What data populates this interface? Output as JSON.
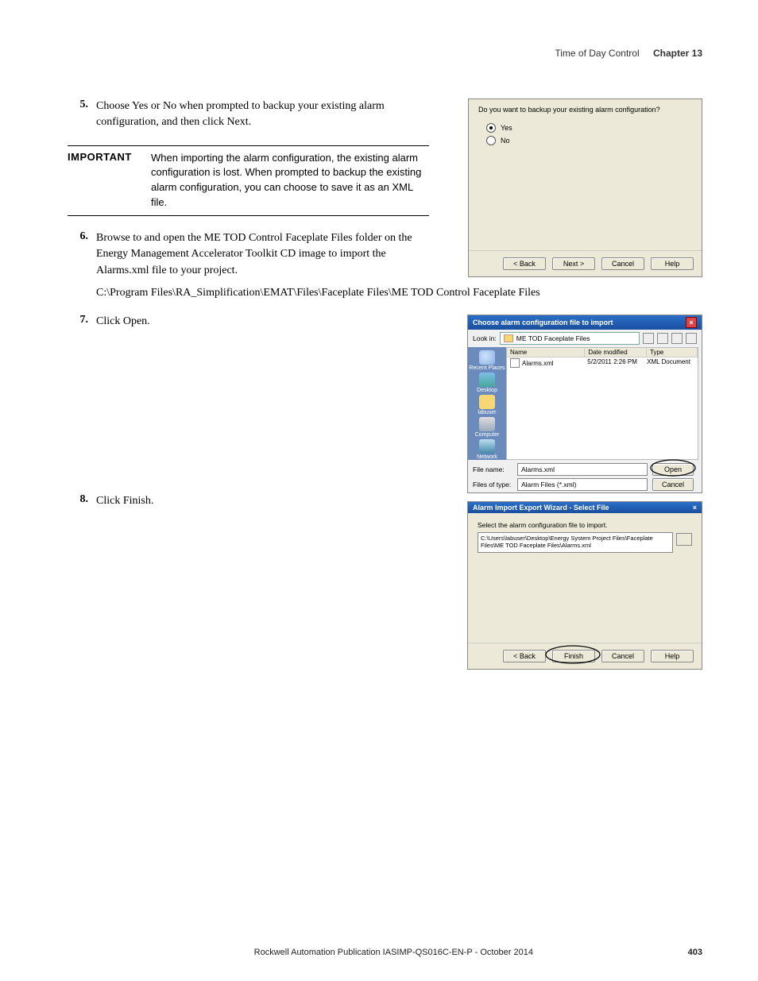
{
  "header": {
    "chapter_name": "Time of Day Control",
    "chapter_num": "Chapter 13"
  },
  "steps": {
    "s5": {
      "num": "5.",
      "text": "Choose Yes or No when prompted to backup your existing alarm configuration, and then click Next."
    },
    "s6": {
      "num": "6.",
      "text": "Browse to and open the ME TOD Control Faceplate Files folder on the Energy Management Accelerator Toolkit CD image to import the Alarms.xml file to your project."
    },
    "s7": {
      "num": "7.",
      "text": "Click Open."
    },
    "s8": {
      "num": "8.",
      "text": "Click Finish."
    }
  },
  "important": {
    "label": "IMPORTANT",
    "text": "When importing the alarm configuration, the existing alarm configuration is lost. When prompted to backup the existing alarm configuration, you can choose to save it as an XML file."
  },
  "path": "C:\\Program Files\\RA_Simplification\\EMAT\\Files\\Faceplate Files\\ME TOD Control Faceplate Files",
  "mock1": {
    "question": "Do you want to backup your existing alarm configuration?",
    "yes": "Yes",
    "no": "No",
    "back": "< Back",
    "next": "Next >",
    "cancel": "Cancel",
    "help": "Help"
  },
  "mock2": {
    "title": "Choose alarm configuration file to import",
    "look_in_label": "Look in:",
    "look_in_value": "ME TOD Faceplate Files",
    "col_name": "Name",
    "col_date": "Date modified",
    "col_type": "Type",
    "file_name": "Alarms.xml",
    "file_date": "5/2/2011 2:26 PM",
    "file_type": "XML Document",
    "places": {
      "recent": "Recent Places",
      "desktop": "Desktop",
      "user": "labuser",
      "computer": "Computer",
      "network": "Network"
    },
    "filename_label": "File name:",
    "filename_value": "Alarms.xml",
    "filetype_label": "Files of type:",
    "filetype_value": "Alarm Files (*.xml)",
    "open": "Open",
    "cancel": "Cancel"
  },
  "mock3": {
    "title": "Alarm Import Export Wizard - Select File",
    "label": "Select the alarm configuration file to import.",
    "path": "C:\\Users\\labuser\\Desktop\\Energy System Project Files\\Faceplate Files\\ME TOD Faceplate Files\\Alarms.xml",
    "back": "< Back",
    "finish": "Finish",
    "cancel": "Cancel",
    "help": "Help"
  },
  "footer": {
    "pub": "Rockwell Automation Publication IASIMP-QS016C-EN-P - October 2014",
    "page": "403"
  }
}
